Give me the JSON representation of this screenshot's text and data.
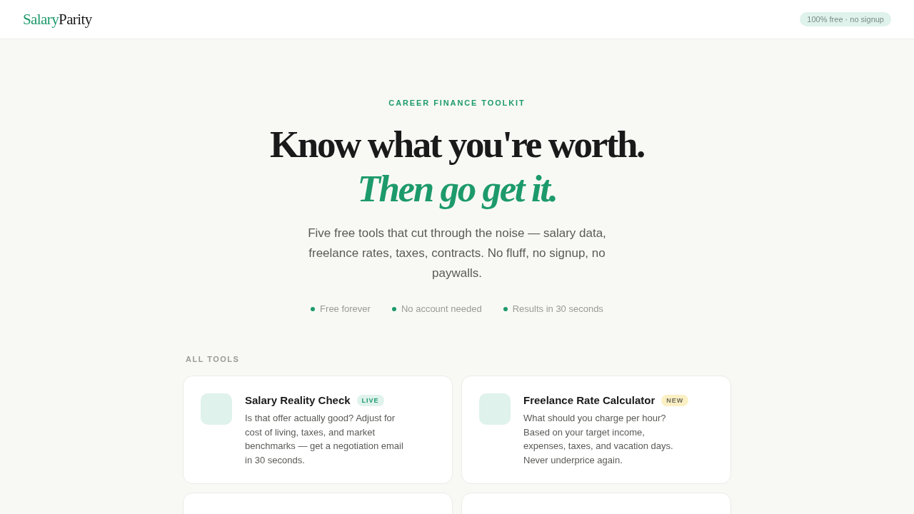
{
  "header": {
    "logo": {
      "accent": "Salary",
      "rest": "Parity"
    },
    "pill": "100% free · no signup"
  },
  "hero": {
    "eyebrow": "CAREER FINANCE TOOLKIT",
    "title": "Know what you're worth.",
    "title_accent": "Then go get it.",
    "subtitle": "Five free tools that cut through the noise — salary data, freelance rates, taxes, contracts. No fluff, no signup, no paywalls.",
    "features": [
      "Free forever",
      "No account needed",
      "Results in 30 seconds"
    ]
  },
  "tools": {
    "heading": "ALL TOOLS",
    "cards": [
      {
        "title": "Salary Reality Check",
        "badge": {
          "label": "LIVE",
          "kind": "live"
        },
        "description": "Is that offer actually good? Adjust for cost of living, taxes, and market benchmarks — get a negotiation email in 30 seconds."
      },
      {
        "title": "Freelance Rate Calculator",
        "badge": {
          "label": "NEW",
          "kind": "new"
        },
        "description": "What should you charge per hour? Based on your target income, expenses, taxes, and vacation days. Never underprice again."
      }
    ]
  }
}
